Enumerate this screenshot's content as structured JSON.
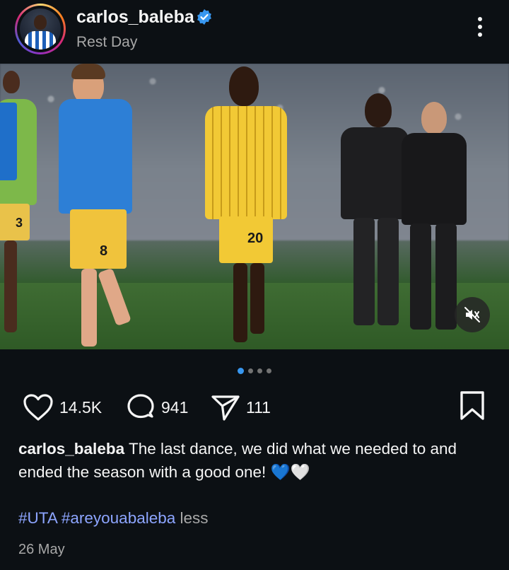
{
  "post": {
    "username": "carlos_baleba",
    "subtitle": "Rest Day",
    "verified": true
  },
  "media": {
    "description_icon": "photo",
    "mute_icon": "speaker-muted-icon",
    "carousel": {
      "total": 4,
      "active_index": 0
    },
    "players": [
      {
        "number": "3",
        "kit": "yellow"
      },
      {
        "number": "8",
        "kit": "blue-yellow"
      },
      {
        "number": "20",
        "kit": "yellow"
      }
    ]
  },
  "actions": {
    "likes": "14.5K",
    "comments": "941",
    "shares": "111"
  },
  "caption": {
    "username": "carlos_baleba",
    "text": "The last dance, we did what we needed to and ended the season with a good one! 💙🤍"
  },
  "hashtags": [
    "#UTA",
    "#areyouabaleba"
  ],
  "more_label": "less",
  "date": "26 May",
  "colors": {
    "background": "#0c1014",
    "verified": "#3897f0",
    "hashtag": "#8da5ff",
    "muted_text": "#a8a8a8"
  }
}
